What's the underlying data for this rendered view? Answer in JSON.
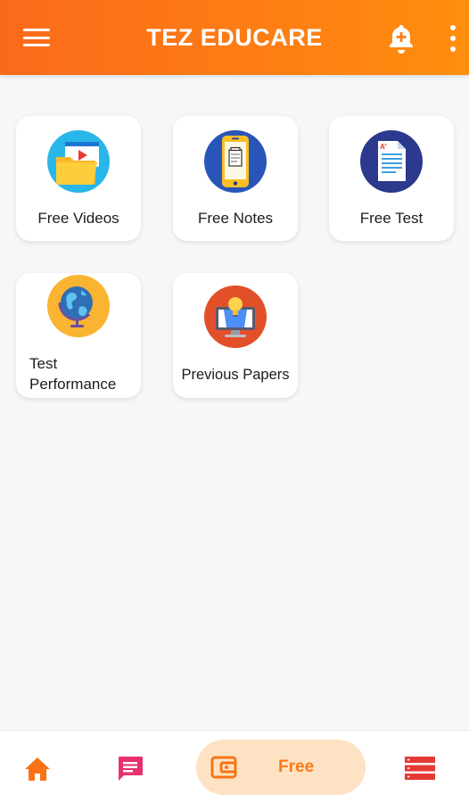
{
  "app": {
    "title": "TEZ EDUCARE"
  },
  "header_icons": {
    "menu": "hamburger-menu-icon",
    "notifications": "bell-plus-icon",
    "more": "vertical-dots-icon"
  },
  "tiles": [
    {
      "label": "Free Videos",
      "icon": "video-folder-icon"
    },
    {
      "label": "Free Notes",
      "icon": "phone-notes-icon"
    },
    {
      "label": "Free Test",
      "icon": "test-document-icon"
    },
    {
      "label": "Test Performance",
      "icon": "globe-icon"
    },
    {
      "label": "Previous Papers",
      "icon": "monitor-bulb-icon"
    }
  ],
  "bottom_nav": {
    "home_icon": "home-icon",
    "chat_icon": "chat-icon",
    "free_label": "Free",
    "wallet_icon": "wallet-icon",
    "list_icon": "list-icon"
  },
  "colors": {
    "header_start": "#fb6a1b",
    "header_end": "#ff8e0e",
    "accent": "#fb7a19",
    "chat_pink": "#e8306e",
    "list_red": "#e53935",
    "free_pill": "#fde3c3"
  }
}
